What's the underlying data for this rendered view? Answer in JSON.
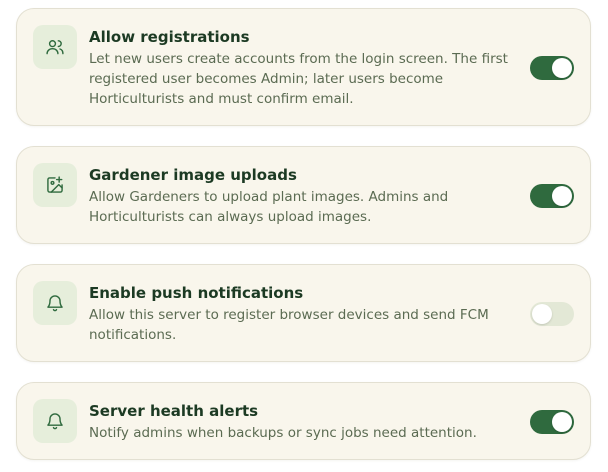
{
  "colors": {
    "accent": "#2f6a3e",
    "card_background": "#f9f6ec",
    "icon_tile_background": "#e6eedb",
    "title_text": "#1c3a23",
    "description_text": "#5b6b52",
    "toggle_off": "#e3e8d6"
  },
  "settings": [
    {
      "icon": "users-icon",
      "title": "Allow registrations",
      "description": "Let new users create accounts from the login screen. The first registered user becomes Admin; later users become Horticulturists and must confirm email.",
      "enabled": true
    },
    {
      "icon": "image-plus-icon",
      "title": "Gardener image uploads",
      "description": "Allow Gardeners to upload plant images. Admins and Horticulturists can always upload images.",
      "enabled": true
    },
    {
      "icon": "bell-icon",
      "title": "Enable push notifications",
      "description": "Allow this server to register browser devices and send FCM notifications.",
      "enabled": false
    },
    {
      "icon": "bell-icon",
      "title": "Server health alerts",
      "description": "Notify admins when backups or sync jobs need attention.",
      "enabled": true
    }
  ]
}
